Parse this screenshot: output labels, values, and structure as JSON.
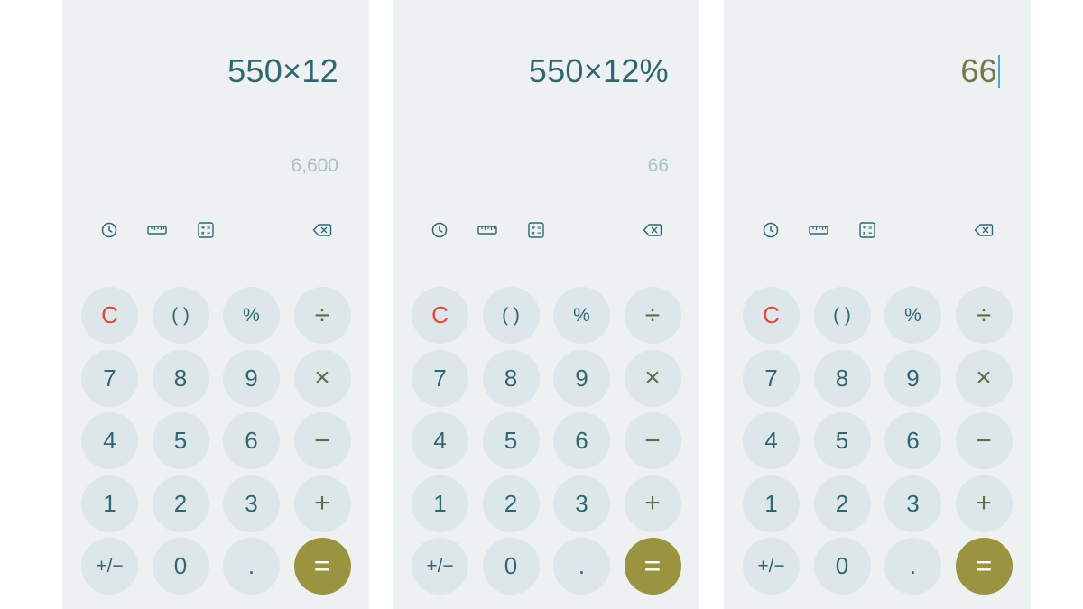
{
  "colors": {
    "background": "#edf1f2",
    "key": "#dde7ea",
    "digit_text": "#2f6670",
    "clear_text": "#e0473c",
    "equals_key": "#9a9440",
    "preview_text": "#a9c3c9"
  },
  "screens": [
    {
      "expression": "550×12",
      "preview": "6,600",
      "cursor": false
    },
    {
      "expression": "550×12%",
      "preview": "66",
      "cursor": false
    },
    {
      "expression": "66",
      "preview": "",
      "cursor": true
    }
  ],
  "toolbar_icons": [
    "history-icon",
    "ruler-icon",
    "scientific-icon",
    "backspace-icon"
  ],
  "keys": [
    {
      "label": "C",
      "kind": "clear",
      "name": "clear-key"
    },
    {
      "label": "( )",
      "kind": "small",
      "name": "parentheses-key"
    },
    {
      "label": "%",
      "kind": "small",
      "name": "percent-key"
    },
    {
      "label": "÷",
      "kind": "op",
      "name": "divide-key"
    },
    {
      "label": "7",
      "kind": "digit",
      "name": "digit-7-key"
    },
    {
      "label": "8",
      "kind": "digit",
      "name": "digit-8-key"
    },
    {
      "label": "9",
      "kind": "digit",
      "name": "digit-9-key"
    },
    {
      "label": "×",
      "kind": "op",
      "name": "multiply-key"
    },
    {
      "label": "4",
      "kind": "digit",
      "name": "digit-4-key"
    },
    {
      "label": "5",
      "kind": "digit",
      "name": "digit-5-key"
    },
    {
      "label": "6",
      "kind": "digit",
      "name": "digit-6-key"
    },
    {
      "label": "−",
      "kind": "op",
      "name": "minus-key"
    },
    {
      "label": "1",
      "kind": "digit",
      "name": "digit-1-key"
    },
    {
      "label": "2",
      "kind": "digit",
      "name": "digit-2-key"
    },
    {
      "label": "3",
      "kind": "digit",
      "name": "digit-3-key"
    },
    {
      "label": "+",
      "kind": "op",
      "name": "plus-key"
    },
    {
      "label": "+/−",
      "kind": "small",
      "name": "sign-toggle-key"
    },
    {
      "label": "0",
      "kind": "digit",
      "name": "digit-0-key"
    },
    {
      "label": ".",
      "kind": "digit",
      "name": "decimal-key"
    },
    {
      "label": "=",
      "kind": "equals",
      "name": "equals-key"
    }
  ]
}
